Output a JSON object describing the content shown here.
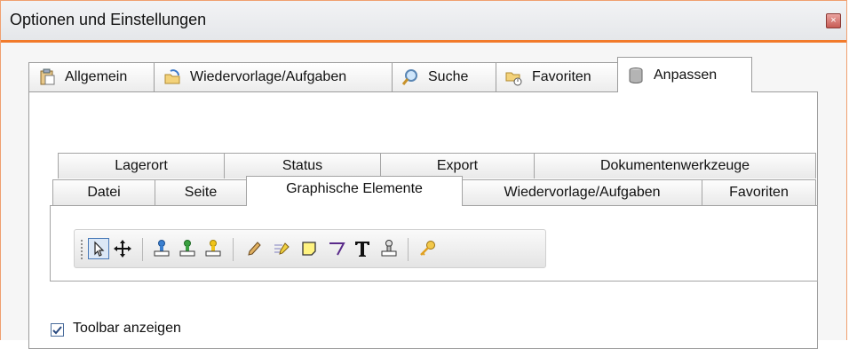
{
  "window": {
    "title": "Optionen und Einstellungen",
    "close_glyph": "×"
  },
  "main_tabs": [
    {
      "label": "Allgemein",
      "icon": "clipboard-icon"
    },
    {
      "label": "Wiedervorlage/Aufgaben",
      "icon": "folder-arrow-icon"
    },
    {
      "label": "Suche",
      "icon": "magnifier-icon"
    },
    {
      "label": "Favoriten",
      "icon": "folder-star-icon"
    },
    {
      "label": "Anpassen",
      "icon": "database-icon",
      "active": true
    }
  ],
  "sub_tabs_row1": [
    "Lagerort",
    "Status",
    "Export",
    "Dokumentenwerkzeuge"
  ],
  "sub_tabs_row2": [
    "Datei",
    "Seite",
    "Graphische Elemente",
    "Wiedervorlage/Aufgaben",
    "Favoriten"
  ],
  "active_sub_tab": "Graphische Elemente",
  "toolbar_tools": [
    "pointer-icon",
    "move-icon",
    "stamp-blue-icon",
    "stamp-green-icon",
    "stamp-yellow-icon",
    "pen-icon",
    "highlight-icon",
    "note-icon",
    "line-icon",
    "text-icon",
    "stamp-icon",
    "key-icon"
  ],
  "show_toolbar": {
    "label": "Toolbar anzeigen",
    "checked": true
  },
  "colors": {
    "accent": "#f27a2a",
    "border": "#9c9c9c"
  }
}
